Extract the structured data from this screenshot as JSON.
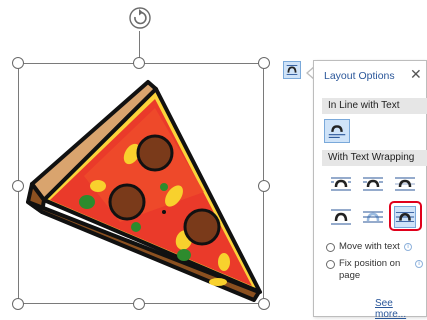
{
  "layout_options": {
    "title": "Layout Options",
    "close_glyph": "✕",
    "inline_header": "In Line with Text",
    "wrap_header": "With Text Wrapping",
    "move_with_text": "Move with text",
    "fix_position": "Fix position on",
    "fix_position_2": "page",
    "see_more": "See more...",
    "info_glyph": "i"
  },
  "colors": {
    "highlight": "#e0001b",
    "accent": "#2b579a",
    "selected_bg": "#cfe3f8"
  },
  "icons": [
    "rotate-icon",
    "layout-options-icon",
    "close-icon",
    "pizza-slice-image",
    "wrap-option-icon",
    "info-icon"
  ]
}
